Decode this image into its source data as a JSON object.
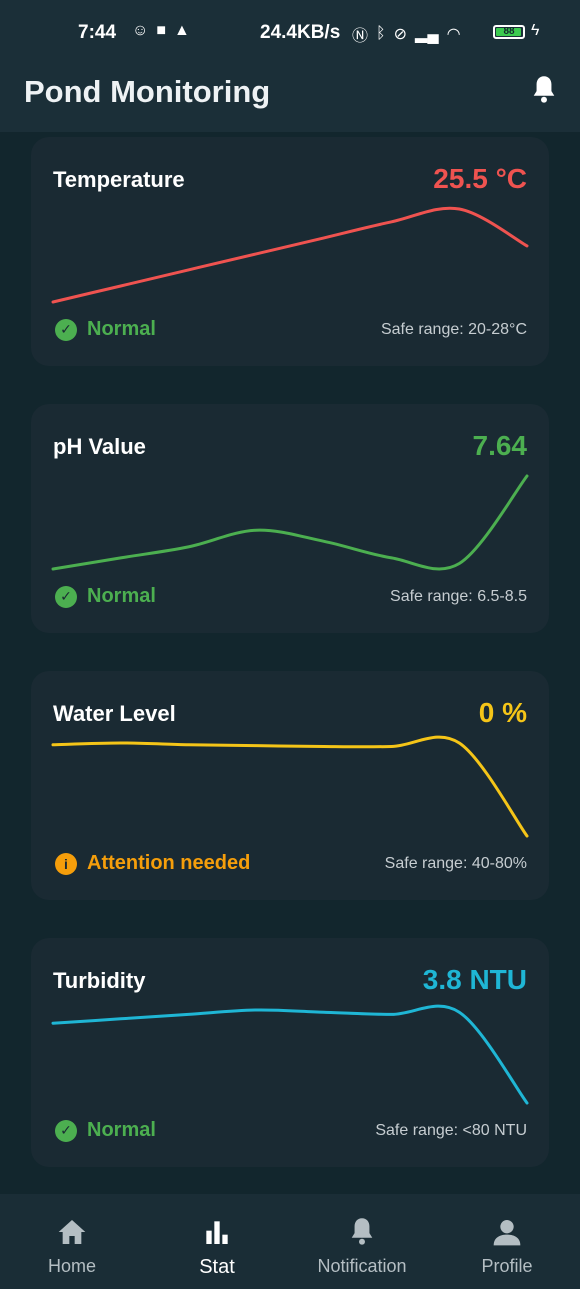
{
  "status_bar": {
    "time": "7:44",
    "net_speed": "24.4KB/s",
    "battery": "88"
  },
  "app": {
    "title": "Pond Monitoring",
    "notification_icon": "bell-icon"
  },
  "cards": [
    {
      "title": "Temperature",
      "value": "25.5 °C",
      "color": "#ef5350",
      "status": "Normal",
      "status_color": "#4caf50",
      "status_icon": "check-circle-icon",
      "safe_range": "Safe range: 20-28°C",
      "trend": [
        22.0,
        23.0,
        24.0,
        25.0,
        26.0,
        27.0,
        27.8,
        25.5
      ]
    },
    {
      "title": "pH Value",
      "value": "7.64",
      "color": "#4caf50",
      "status": "Normal",
      "status_color": "#4caf50",
      "status_icon": "check-circle-icon",
      "safe_range": "Safe range: 6.5-8.5",
      "trend": [
        6.8,
        6.9,
        7.0,
        7.15,
        7.05,
        6.9,
        6.85,
        7.64
      ]
    },
    {
      "title": "Water Level",
      "value": "0 %",
      "color": "#f5c518",
      "status": "Attention needed",
      "status_color": "#f59e0b",
      "status_icon": "info-circle-icon",
      "safe_range": "Safe range: 40-80%",
      "trend": [
        52,
        53,
        52,
        51.5,
        51,
        51,
        53,
        0
      ]
    },
    {
      "title": "Turbidity",
      "value": "3.8 NTU",
      "color": "#1fb6d5",
      "status": "Normal",
      "status_color": "#4caf50",
      "status_icon": "check-circle-icon",
      "safe_range": "Safe range: <80 NTU",
      "trend": [
        40,
        42,
        44,
        46,
        45,
        44,
        45,
        3.8
      ]
    }
  ],
  "nav": [
    {
      "label": "Home",
      "icon": "home-icon",
      "active": false
    },
    {
      "label": "Stat",
      "icon": "bar-chart-icon",
      "active": true
    },
    {
      "label": "Notification",
      "icon": "bell-icon",
      "active": false
    },
    {
      "label": "Profile",
      "icon": "person-icon",
      "active": false
    }
  ]
}
